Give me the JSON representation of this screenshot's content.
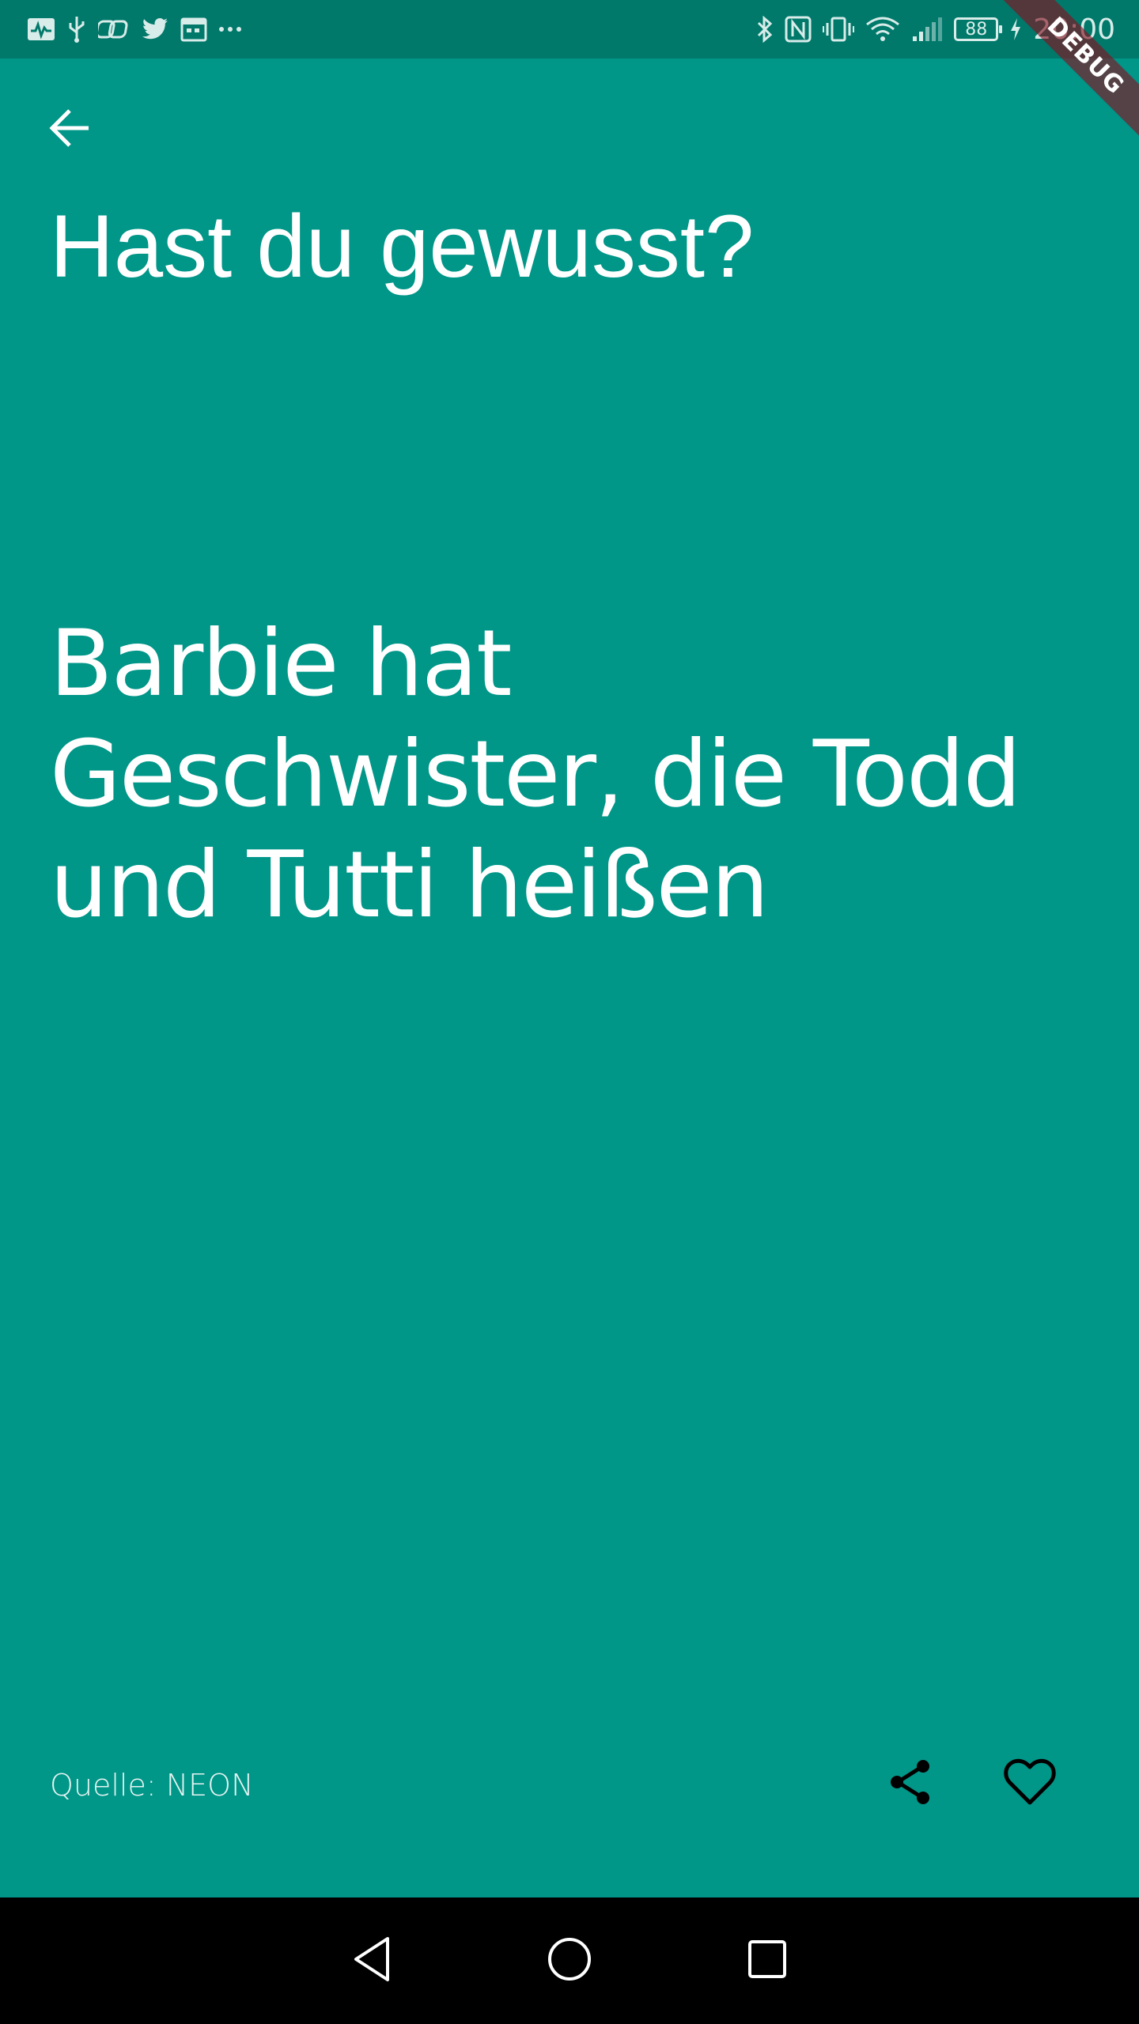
{
  "status_bar": {
    "time": "20:00",
    "battery_level": "88",
    "left_icons": [
      "activity-icon",
      "usb-icon",
      "link-icon",
      "twitter-icon",
      "calendar-icon",
      "more-notifications-icon"
    ],
    "right_icons": [
      "bluetooth-icon",
      "nfc-icon",
      "vibrate-icon",
      "wifi-icon",
      "signal-icon",
      "battery-icon",
      "charging-icon"
    ]
  },
  "debug_banner": "DEBUG",
  "header": {
    "back_icon": "arrow-back-icon",
    "title": "Hast du gewusst?"
  },
  "fact": {
    "text": "Barbie hat Geschwister, die Todd und Tutti heißen"
  },
  "footer": {
    "source": "Quelle: NEON",
    "share_icon": "share-icon",
    "favorite_icon": "heart-outline-icon"
  },
  "navigation_bar": {
    "buttons": [
      "nav-back-icon",
      "nav-home-icon",
      "nav-recents-icon"
    ]
  },
  "colors": {
    "background": "#009688",
    "status_bar": "#00796b",
    "text": "#ffffff",
    "nav_bar": "#000000"
  }
}
